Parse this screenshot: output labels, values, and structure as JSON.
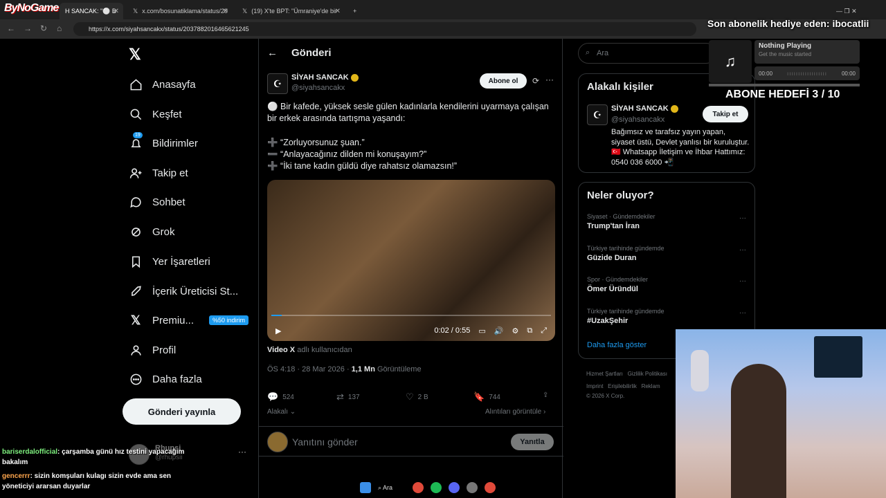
{
  "browser": {
    "tabs": [
      {
        "label": "H SANCAK: \"⚪ B"
      },
      {
        "label": "x.com/bosunatiklama/status/20"
      },
      {
        "label": "(19) X'te BPT: \"Ümraniye'de bir"
      }
    ],
    "url": "https://x.com/siyahsancakx/status/2037882016465621245",
    "logo": "ByNoGame"
  },
  "stream": {
    "subscription_gift": "Son abonelik hediye eden: ibocatlii",
    "goal": "ABONE HEDEFİ 3 / 10",
    "music_title": "Nothing Playing",
    "music_subtitle": "Get the music started",
    "music_time_start": "00:00",
    "music_time_end": "00:00",
    "chat": [
      {
        "user": "bariserdalofficial",
        "text": ": çarşamba günü hız testini yapacağım bakalım"
      },
      {
        "user": "gencerrr",
        "text": ": sizin komşuları kulagı sizin evde ama sen yöneticiyi ararsan duyarlar"
      }
    ]
  },
  "sidebar": {
    "items": [
      {
        "label": "Anasayfa",
        "icon": "home-icon"
      },
      {
        "label": "Keşfet",
        "icon": "search-icon"
      },
      {
        "label": "Bildirimler",
        "icon": "bell-icon",
        "badge": "19"
      },
      {
        "label": "Takip et",
        "icon": "follow-icon"
      },
      {
        "label": "Sohbet",
        "icon": "chat-icon"
      },
      {
        "label": "Grok",
        "icon": "grok-icon"
      },
      {
        "label": "Yer İşaretleri",
        "icon": "bookmark-icon"
      },
      {
        "label": "İçerik Üreticisi St...",
        "icon": "rocket-icon"
      },
      {
        "label": "Premiu...",
        "icon": "x-icon",
        "tag": "%50 indirim"
      },
      {
        "label": "Profil",
        "icon": "person-icon"
      },
      {
        "label": "Daha fazla",
        "icon": "more-icon"
      }
    ],
    "post_button": "Gönderi yayınla",
    "account_name": "Rhupsi",
    "account_handle": "@rhupsii"
  },
  "post": {
    "header": "Gönderi",
    "author_name": "SİYAH SANCAK",
    "author_handle": "@siyahsancakx",
    "subscribe": "Abone ol",
    "text_1": "⚪ Bir kafede, yüksek sesle gülen kadınlarla kendilerini uyarmaya çalışan bir erkek arasında tartışma yaşandı:",
    "quote_1": "“Zorluyorsunuz şuan.”",
    "quote_2": "“Anlayacağınız dilden mi konuşayım?”",
    "quote_3": "“İki tane kadın güldü diye rahatsız olamazsın!”",
    "video_time": "0:02 / 0:55",
    "video_progress": 0.036,
    "video_credit_name": "Video X",
    "video_credit_rest": "adlı kullanıcıdan",
    "timestamp": "ÖS 4:18 · 28 Mar 2026 ·",
    "views_count": "1,1 Mn",
    "views_label": "Görüntüleme",
    "replies": "524",
    "reposts": "137",
    "likes": "2 B",
    "bookmarks": "744",
    "related": "Alakalı",
    "quotes": "Alıntıları görüntüle",
    "reply_placeholder": "Yanıtını gönder",
    "reply_button": "Yanıtla"
  },
  "right": {
    "search_placeholder": "Ara",
    "related_title": "Alakalı kişiler",
    "rp_name": "SİYAH SANCAK",
    "rp_handle": "@siyahsancakx",
    "rp_follow": "Takip et",
    "rp_bio": "Bağımsız ve tarafsız yayın yapan, siyaset üstü, Devlet yanlısı bir kuruluştur. 🇹🇷 Whatsapp İletişim ve İhbar Hattımız: 0540 036 6000 📲",
    "trends_title": "Neler oluyor?",
    "trends": [
      {
        "context": "Siyaset · Gündemdekiler",
        "title": "Trump'tan İran"
      },
      {
        "context": "Türkiye tarihinde gündemde",
        "title": "Güzide Duran"
      },
      {
        "context": "Spor · Gündemdekiler",
        "title": "Ömer Üründül"
      },
      {
        "context": "Türkiye tarihinde gündemde",
        "title": "#UzakŞehir"
      }
    ],
    "show_more": "Daha fazla göster",
    "footer_1": "Hizmet Şartları",
    "footer_2": "Gizlilik Politikası",
    "footer_3": "Imprint",
    "footer_4": "Erişilebilirlik",
    "footer_5": "Reklam",
    "copyright": "© 2026 X Corp."
  },
  "taskbar": {
    "search": "Ara"
  }
}
